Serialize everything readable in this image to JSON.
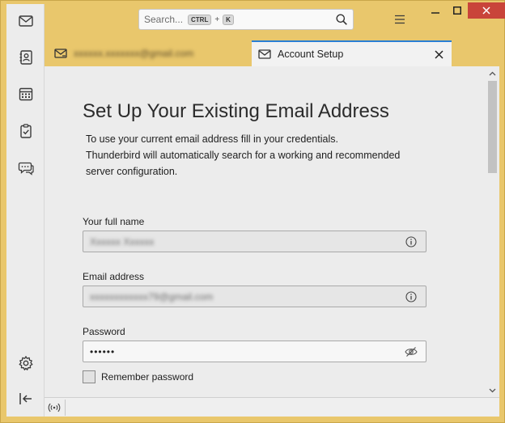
{
  "window": {
    "accent": "#e9c76c",
    "close_color": "#c9443a"
  },
  "spaces": [
    {
      "icon": "mail-icon"
    },
    {
      "icon": "address-book-icon"
    },
    {
      "icon": "calendar-icon"
    },
    {
      "icon": "tasks-icon"
    },
    {
      "icon": "chat-icon"
    },
    {
      "icon": "settings-gear-icon"
    },
    {
      "icon": "collapse-sidebar-icon"
    }
  ],
  "search": {
    "placeholder": "Search...",
    "shortcut_key1": "CTRL",
    "shortcut_plus": "+",
    "shortcut_key2": "K"
  },
  "tabs": [
    {
      "label": "xxxxxx.xxxxxxx@gmail.com",
      "active": false
    },
    {
      "label": "Account Setup",
      "active": true
    }
  ],
  "page": {
    "title": "Set Up Your Existing Email Address",
    "intro_line1": "To use your current email address fill in your credentials.",
    "intro_line2": "Thunderbird will automatically search for a working and recommended",
    "intro_line3": "server configuration."
  },
  "form": {
    "name_label": "Your full name",
    "name_value": "Xxxxxx Xxxxxx",
    "email_label": "Email address",
    "email_value": "xxxxxxxxxxxx79@gmail.com",
    "password_label": "Password",
    "password_value": "••••••",
    "remember_label": "Remember password",
    "remember_checked": false
  },
  "accent_color": "#2a7fd4"
}
